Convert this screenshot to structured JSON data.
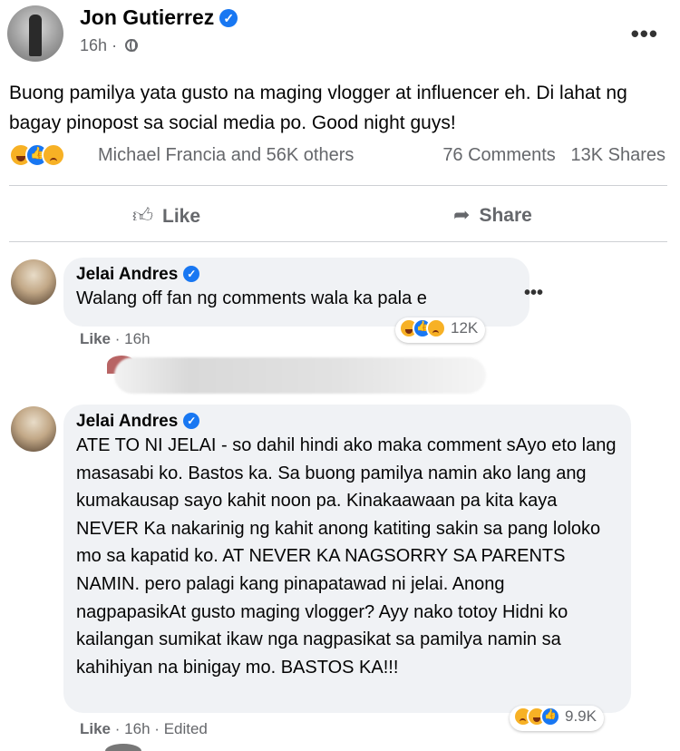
{
  "post": {
    "author": "Jon Gutierrez",
    "timestamp": "16h",
    "separator": "·",
    "text": "Buong pamilya yata gusto na maging vlogger at influencer eh. Di lahat ng bagay pinopost sa social media po. Good night guys!",
    "reaction_icons": [
      "haha-icon",
      "like-icon",
      "sad-icon"
    ],
    "reaction_summary": "Michael Francia and 56K others",
    "comments_count": "76 Comments",
    "shares_count": "13K Shares"
  },
  "actions": {
    "like_label": "Like",
    "share_label": "Share"
  },
  "comments": [
    {
      "author": "Jelai Andres",
      "text": "Walang off fan ng comments wala ka pala e",
      "like_label": "Like",
      "separator": "·",
      "time": "16h",
      "reaction_count": "12K"
    },
    {
      "author": "Jelai Andres",
      "text": "ATE TO NI JELAI - so dahil hindi ako maka comment sAyo eto lang masasabi ko. Bastos ka. Sa buong pamilya namin ako lang ang kumakausap sayo kahit noon pa. Kinakaawaan pa kita kaya NEVER Ka nakarinig ng kahit anong katiting sakin sa pang loloko mo sa kapatid ko. AT NEVER KA NAGSORRY SA PARENTS NAMIN. pero palagi kang pinapatawad ni jelai. Anong nagpapasikAt gusto maging vlogger? Ayy nako totoy Hidni ko kailangan sumikat ikaw nga nagpasikat sa pamilya namin sa kahihiyan na binigay mo. BASTOS KA!!!",
      "like_label": "Like",
      "separator": "·",
      "time": "16h",
      "edited": "Edited",
      "reaction_count": "9.9K"
    }
  ],
  "colors": {
    "verified_blue": "#1877f2",
    "meta_gray": "#65676b",
    "bubble_bg": "#f0f2f5"
  }
}
